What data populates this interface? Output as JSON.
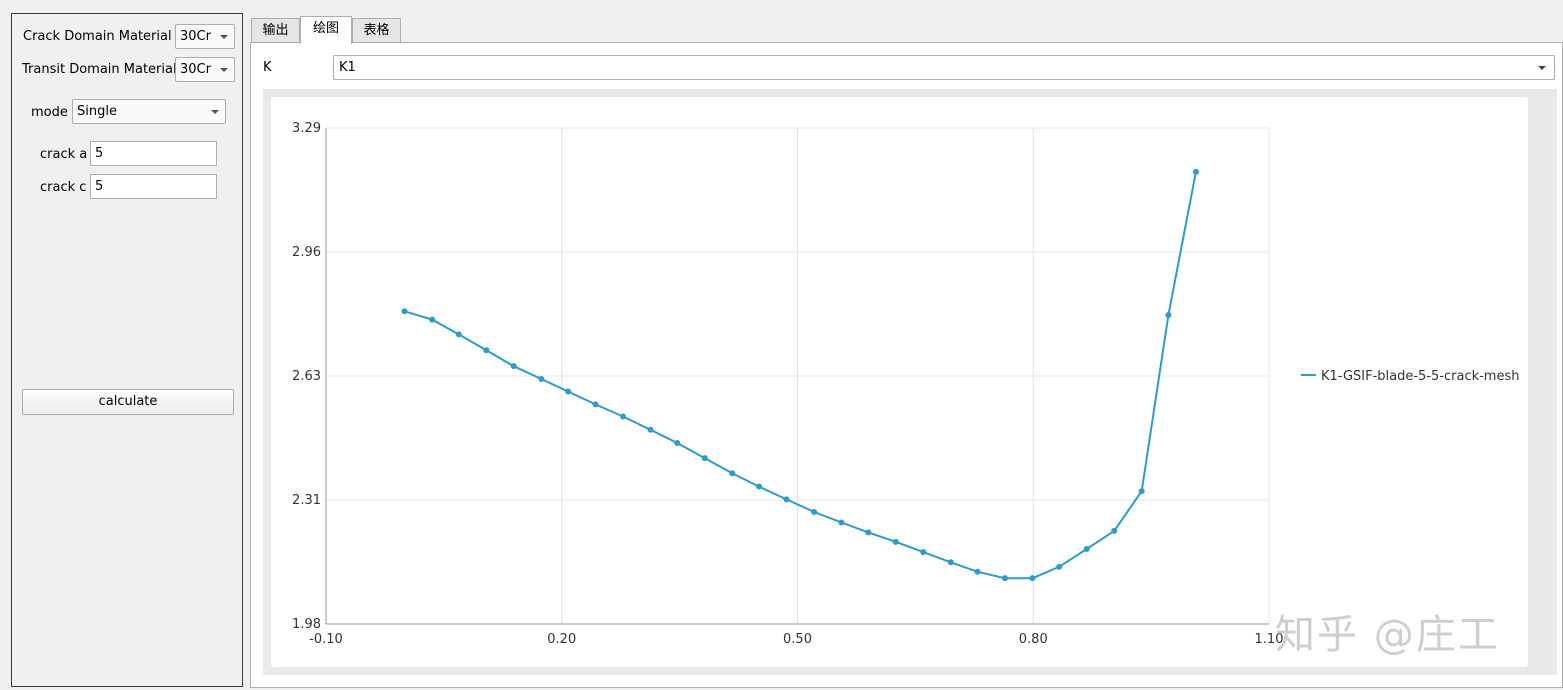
{
  "left_panel": {
    "crack_domain_material": {
      "label": "Crack Domain Material",
      "value": "30Cr"
    },
    "transit_domain_material": {
      "label": "Transit Domain Material",
      "value": "30Cr"
    },
    "mode": {
      "label": "mode",
      "value": "Single"
    },
    "crack_a": {
      "label": "crack a",
      "value": "5"
    },
    "crack_c": {
      "label": "crack c",
      "value": "5"
    },
    "calculate_label": "calculate"
  },
  "tabs": [
    {
      "label": "输出"
    },
    {
      "label": "绘图",
      "active": true
    },
    {
      "label": "表格"
    }
  ],
  "plot_panel": {
    "k_label": "K",
    "k_value": "K1"
  },
  "watermark": "知乎 @庄工",
  "colors": {
    "series": "#2e9bc8",
    "grid": "#e4e4e4",
    "axis": "#9a9a9a"
  },
  "chart_data": {
    "type": "line",
    "title": "",
    "xlabel": "",
    "ylabel": "",
    "xlim": [
      -0.1,
      1.1
    ],
    "ylim": [
      1.98,
      3.29
    ],
    "x_ticks": [
      "-0.10",
      "0.20",
      "0.50",
      "0.80",
      "1.10"
    ],
    "y_ticks": [
      "1.98",
      "2.31",
      "2.63",
      "2.96",
      "3.29"
    ],
    "grid": true,
    "legend_position": "right",
    "series": [
      {
        "name": "K1-GSIF-blade-5-5-crack-mesh",
        "x": [
          0.0,
          0.035,
          0.069,
          0.104,
          0.139,
          0.174,
          0.208,
          0.243,
          0.278,
          0.313,
          0.347,
          0.382,
          0.417,
          0.451,
          0.486,
          0.521,
          0.556,
          0.59,
          0.625,
          0.66,
          0.695,
          0.729,
          0.764,
          0.799,
          0.833,
          0.868,
          0.903,
          0.938,
          0.972,
          1.007
        ],
        "y": [
          2.806,
          2.784,
          2.745,
          2.703,
          2.661,
          2.627,
          2.594,
          2.56,
          2.528,
          2.493,
          2.458,
          2.418,
          2.378,
          2.343,
          2.309,
          2.276,
          2.248,
          2.222,
          2.197,
          2.17,
          2.143,
          2.118,
          2.101,
          2.101,
          2.131,
          2.178,
          2.226,
          2.331,
          2.796,
          3.174
        ]
      }
    ]
  }
}
